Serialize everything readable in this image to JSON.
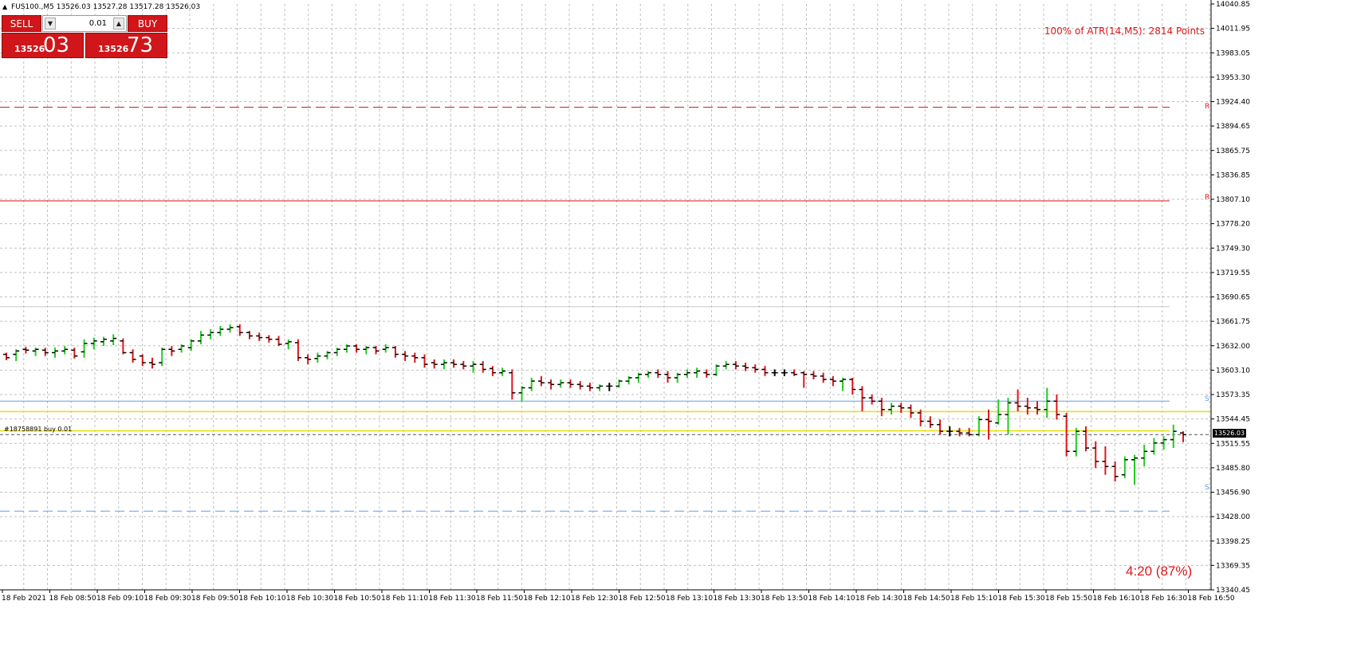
{
  "header": {
    "symbol_timeframe": "FUS100.,M5",
    "ohlc": "13526.03 13527.28 13517.28 13526.03"
  },
  "trade_panel": {
    "sell_label": "SELL",
    "buy_label": "BUY",
    "lot_value": "0.01",
    "sell_price_big": "13526",
    "sell_price_large": "03",
    "buy_price_big": "13526",
    "buy_price_large": "73"
  },
  "atr_text": "100% of ATR(14,M5): 2814  Points",
  "timer_text": "4:20 (87%)",
  "order_label": "#18758891 buy 0.01",
  "current_price": "13526.03",
  "level_tags": {
    "r": "R",
    "s": "S"
  },
  "colors": {
    "bull_bar": "#22cc22",
    "bear_bar": "#e0161a",
    "neutral_bar": "#000000",
    "resistance": "#e0161a",
    "support": "#5aa0e8",
    "pivot": "#c8c8c8",
    "order": "#e8e000",
    "accent_panel": "#d0161a"
  },
  "chart_data": {
    "type": "ohlc",
    "symbol": "FUS100.",
    "timeframe": "M5",
    "ylim": [
      13340.45,
      14040.85
    ],
    "y_ticks": [
      "14040.85",
      "14011.95",
      "13983.05",
      "13953.30",
      "13924.40",
      "13894.65",
      "13865.75",
      "13836.85",
      "13807.10",
      "13778.20",
      "13749.30",
      "13719.55",
      "13690.65",
      "13661.75",
      "13632.00",
      "13603.10",
      "13573.35",
      "13544.45",
      "13515.55",
      "13485.80",
      "13456.90",
      "13428.00",
      "13398.25",
      "13369.35",
      "13340.45"
    ],
    "x_ticks": [
      "18 Feb 2021",
      "18 Feb 08:50",
      "18 Feb 09:10",
      "18 Feb 09:30",
      "18 Feb 09:50",
      "18 Feb 10:10",
      "18 Feb 10:30",
      "18 Feb 10:50",
      "18 Feb 11:10",
      "18 Feb 11:30",
      "18 Feb 11:50",
      "18 Feb 12:10",
      "18 Feb 12:30",
      "18 Feb 12:50",
      "18 Feb 13:10",
      "18 Feb 13:30",
      "18 Feb 13:50",
      "18 Feb 14:10",
      "18 Feb 14:30",
      "18 Feb 14:50",
      "18 Feb 15:10",
      "18 Feb 15:30",
      "18 Feb 15:50",
      "18 Feb 16:10",
      "18 Feb 16:30",
      "18 Feb 16:50"
    ],
    "levels": [
      {
        "name": "R",
        "value": 13917.5,
        "style": "dashed",
        "color": "#e0161a"
      },
      {
        "name": "R",
        "value": 13805.5,
        "style": "solid",
        "color": "#e0161a"
      },
      {
        "name": "pivot",
        "value": 13679.0,
        "style": "solid",
        "color": "#c8c8c8"
      },
      {
        "name": "S",
        "value": 13566.0,
        "style": "solid",
        "color": "#5aa0e8"
      },
      {
        "name": "order-sl",
        "value": 13553.5,
        "style": "solid",
        "color": "#e8e000"
      },
      {
        "name": "order",
        "value": 13530.5,
        "style": "solid",
        "color": "#e8e000"
      },
      {
        "name": "S",
        "value": 13434.5,
        "style": "dashed",
        "color": "#5aa0e8"
      }
    ],
    "bars": [
      [
        13622,
        13624,
        13615,
        13618
      ],
      [
        13622,
        13628,
        13614,
        13626
      ],
      [
        13628,
        13631,
        13623,
        13627
      ],
      [
        13626,
        13630,
        13620,
        13628
      ],
      [
        13627,
        13630,
        13620,
        13624
      ],
      [
        13624,
        13630,
        13618,
        13626
      ],
      [
        13626,
        13632,
        13622,
        13628
      ],
      [
        13627,
        13630,
        13617,
        13620
      ],
      [
        13625,
        13640,
        13618,
        13635
      ],
      [
        13635,
        13642,
        13628,
        13638
      ],
      [
        13637,
        13643,
        13632,
        13640
      ],
      [
        13638,
        13646,
        13633,
        13641
      ],
      [
        13638,
        13641,
        13622,
        13624
      ],
      [
        13624,
        13628,
        13612,
        13616
      ],
      [
        13620,
        13622,
        13608,
        13612
      ],
      [
        13612,
        13618,
        13605,
        13610
      ],
      [
        13612,
        13630,
        13608,
        13628
      ],
      [
        13628,
        13632,
        13620,
        13626
      ],
      [
        13628,
        13634,
        13624,
        13632
      ],
      [
        13630,
        13640,
        13626,
        13638
      ],
      [
        13638,
        13650,
        13634,
        13645
      ],
      [
        13645,
        13652,
        13640,
        13648
      ],
      [
        13648,
        13656,
        13644,
        13652
      ],
      [
        13652,
        13658,
        13648,
        13654
      ],
      [
        13655,
        13658,
        13644,
        13648
      ],
      [
        13648,
        13650,
        13640,
        13644
      ],
      [
        13644,
        13648,
        13638,
        13642
      ],
      [
        13642,
        13645,
        13636,
        13640
      ],
      [
        13640,
        13644,
        13632,
        13634
      ],
      [
        13635,
        13640,
        13628,
        13637
      ],
      [
        13636,
        13640,
        13614,
        13618
      ],
      [
        13618,
        13622,
        13610,
        13616
      ],
      [
        13617,
        13624,
        13612,
        13620
      ],
      [
        13620,
        13626,
        13616,
        13624
      ],
      [
        13624,
        13630,
        13620,
        13628
      ],
      [
        13628,
        13634,
        13624,
        13632
      ],
      [
        13632,
        13634,
        13624,
        13628
      ],
      [
        13628,
        13632,
        13622,
        13630
      ],
      [
        13630,
        13632,
        13622,
        13626
      ],
      [
        13628,
        13634,
        13624,
        13630
      ],
      [
        13630,
        13632,
        13618,
        13622
      ],
      [
        13622,
        13626,
        13614,
        13620
      ],
      [
        13620,
        13624,
        13612,
        13618
      ],
      [
        13618,
        13622,
        13606,
        13610
      ],
      [
        13612,
        13616,
        13605,
        13610
      ],
      [
        13610,
        13616,
        13604,
        13612
      ],
      [
        13612,
        13616,
        13606,
        13610
      ],
      [
        13610,
        13614,
        13604,
        13608
      ],
      [
        13608,
        13614,
        13600,
        13610
      ],
      [
        13610,
        13614,
        13600,
        13604
      ],
      [
        13605,
        13608,
        13596,
        13600
      ],
      [
        13600,
        13606,
        13596,
        13602
      ],
      [
        13600,
        13604,
        13568,
        13576
      ],
      [
        13576,
        13584,
        13566,
        13582
      ],
      [
        13582,
        13594,
        13578,
        13590
      ],
      [
        13590,
        13596,
        13584,
        13588
      ],
      [
        13588,
        13592,
        13580,
        13586
      ],
      [
        13586,
        13592,
        13582,
        13588
      ],
      [
        13588,
        13592,
        13582,
        13586
      ],
      [
        13586,
        13590,
        13580,
        13584
      ],
      [
        13584,
        13588,
        13578,
        13582
      ],
      [
        13582,
        13586,
        13578,
        13584
      ],
      [
        13584,
        13588,
        13578,
        13584
      ],
      [
        13584,
        13592,
        13582,
        13590
      ],
      [
        13590,
        13596,
        13586,
        13594
      ],
      [
        13594,
        13600,
        13588,
        13598
      ],
      [
        13598,
        13602,
        13594,
        13600
      ],
      [
        13600,
        13604,
        13594,
        13598
      ],
      [
        13598,
        13602,
        13588,
        13594
      ],
      [
        13594,
        13600,
        13588,
        13598
      ],
      [
        13598,
        13604,
        13594,
        13600
      ],
      [
        13600,
        13606,
        13594,
        13602
      ],
      [
        13600,
        13604,
        13594,
        13598
      ],
      [
        13598,
        13610,
        13596,
        13608
      ],
      [
        13608,
        13614,
        13604,
        13610
      ],
      [
        13610,
        13614,
        13604,
        13608
      ],
      [
        13608,
        13612,
        13602,
        13606
      ],
      [
        13606,
        13610,
        13600,
        13604
      ],
      [
        13604,
        13608,
        13596,
        13600
      ],
      [
        13600,
        13604,
        13596,
        13600
      ],
      [
        13600,
        13604,
        13596,
        13600
      ],
      [
        13600,
        13604,
        13596,
        13598
      ],
      [
        13600,
        13602,
        13582,
        13598
      ],
      [
        13598,
        13602,
        13592,
        13596
      ],
      [
        13596,
        13600,
        13588,
        13592
      ],
      [
        13592,
        13596,
        13584,
        13590
      ],
      [
        13590,
        13594,
        13578,
        13592
      ],
      [
        13592,
        13594,
        13574,
        13580
      ],
      [
        13580,
        13584,
        13554,
        13570
      ],
      [
        13570,
        13574,
        13562,
        13566
      ],
      [
        13566,
        13570,
        13548,
        13556
      ],
      [
        13556,
        13564,
        13550,
        13560
      ],
      [
        13560,
        13564,
        13552,
        13558
      ],
      [
        13558,
        13562,
        13546,
        13552
      ],
      [
        13552,
        13556,
        13536,
        13542
      ],
      [
        13542,
        13548,
        13534,
        13538
      ],
      [
        13538,
        13544,
        13526,
        13530
      ],
      [
        13530,
        13536,
        13524,
        13530
      ],
      [
        13530,
        13534,
        13524,
        13528
      ],
      [
        13528,
        13534,
        13524,
        13526
      ],
      [
        13526,
        13548,
        13524,
        13544
      ],
      [
        13544,
        13556,
        13520,
        13542
      ],
      [
        13540,
        13568,
        13538,
        13550
      ],
      [
        13550,
        13570,
        13526,
        13564
      ],
      [
        13564,
        13580,
        13554,
        13560
      ],
      [
        13560,
        13570,
        13550,
        13558
      ],
      [
        13558,
        13566,
        13550,
        13556
      ],
      [
        13556,
        13582,
        13546,
        13566
      ],
      [
        13566,
        13574,
        13544,
        13550
      ],
      [
        13548,
        13552,
        13500,
        13506
      ],
      [
        13506,
        13534,
        13500,
        13530
      ],
      [
        13530,
        13536,
        13506,
        13510
      ],
      [
        13510,
        13518,
        13486,
        13494
      ],
      [
        13494,
        13512,
        13478,
        13488
      ],
      [
        13488,
        13494,
        13470,
        13476
      ],
      [
        13478,
        13500,
        13474,
        13496
      ],
      [
        13496,
        13502,
        13466,
        13498
      ],
      [
        13498,
        13514,
        13488,
        13506
      ],
      [
        13506,
        13522,
        13502,
        13516
      ],
      [
        13516,
        13524,
        13508,
        13520
      ],
      [
        13520,
        13538,
        13510,
        13530
      ],
      [
        13528,
        13530,
        13517,
        13526
      ]
    ]
  }
}
